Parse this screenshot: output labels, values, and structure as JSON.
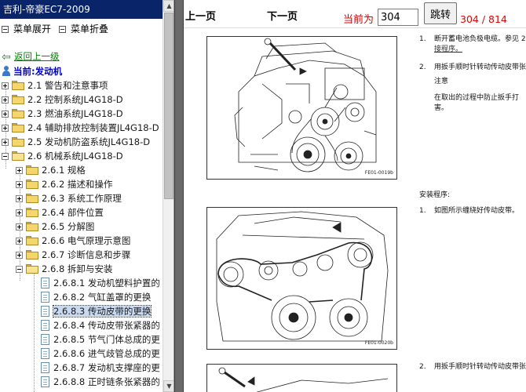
{
  "app": {
    "title": "吉利-帝豪EC7-2009"
  },
  "sidebar": {
    "toolbar": {
      "expand_label": "菜单展开",
      "collapse_label": "菜单折叠"
    },
    "back_label": "返回上一级",
    "current_label": "当前:发动机",
    "sections": [
      {
        "label": "2.1 警告和注意事项"
      },
      {
        "label": "2.2 控制系统JL4G18-D"
      },
      {
        "label": "2.3 燃油系统JL4G18-D"
      },
      {
        "label": "2.4 辅助排放控制装置JL4G18-D"
      },
      {
        "label": "2.5 发动机防盗系统JL4G18-D"
      },
      {
        "label": "2.6 机械系统JL4G18-D"
      }
    ],
    "subsections": [
      {
        "label": "2.6.1 规格"
      },
      {
        "label": "2.6.2 描述和操作"
      },
      {
        "label": "2.6.3 系统工作原理"
      },
      {
        "label": "2.6.4 部件位置"
      },
      {
        "label": "2.6.5 分解图"
      },
      {
        "label": "2.6.6 电气原理示意图"
      },
      {
        "label": "2.6.7 诊断信息和步骤"
      },
      {
        "label": "2.6.8 拆卸与安装"
      }
    ],
    "procedures": [
      {
        "label": "2.6.8.1 发动机塑料护置的"
      },
      {
        "label": "2.6.8.2 气缸盖罩的更换"
      },
      {
        "label": "2.6.8.3 传动皮带的更换"
      },
      {
        "label": "2.6.8.4 传动皮带张紧器的"
      },
      {
        "label": "2.6.8.5 节气门体总成的更"
      },
      {
        "label": "2.6.8.6 进气歧管总成的更"
      },
      {
        "label": "2.6.8.7 发动机支撑座的更"
      },
      {
        "label": "2.6.8.8 正时链条张紧器的"
      }
    ],
    "selected_procedure": "2.6.8.3 传动皮带的更换"
  },
  "toolbar": {
    "prev_label": "上一页",
    "next_label": "下一页",
    "current_page_label": "当前为",
    "page_input_value": "304",
    "jump_label": "跳转",
    "page_count": "304 / 814"
  },
  "document": {
    "figures": [
      {
        "code": "FE01-0019b"
      },
      {
        "code": "FE01-0020b"
      }
    ],
    "steps_block_1": [
      {
        "num": "1.",
        "lines": [
          "断开蓄电池负极电缆。参见 2.",
          "接程序。"
        ]
      },
      {
        "num": "2.",
        "lines": [
          "用扳手顺时针转动传动皮带张"
        ]
      }
    ],
    "notice_title": "注意",
    "notice_lines": [
      "在取出的过程中防止扳手打",
      "害。"
    ],
    "install_heading": "安装程序:",
    "install_steps": [
      {
        "num": "1.",
        "text": "如图所示缠绕好传动皮带。"
      }
    ],
    "bottom_step": {
      "num": "2.",
      "text": "用扳手顺时针转动传动皮带张"
    }
  },
  "colors": {
    "title_bar": "#0a246a",
    "page_red": "#e00000",
    "back_link_green": "#008000",
    "current_blue": "#0000cc",
    "splitter_gray": "#6a6a6a"
  }
}
